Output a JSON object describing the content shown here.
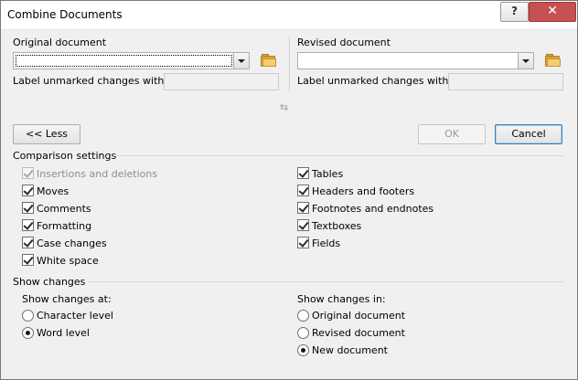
{
  "window": {
    "title": "Combine Documents",
    "help_label": "?",
    "close_label": "✕"
  },
  "original": {
    "label": "Original document",
    "value": "",
    "unmarked_label": "Label unmarked changes with:",
    "unmarked_value": ""
  },
  "revised": {
    "label": "Revised document",
    "value": "",
    "unmarked_label": "Label unmarked changes with:",
    "unmarked_value": ""
  },
  "icons": {
    "browse": "folder-icon",
    "swap": "swap-arrows-icon"
  },
  "swap_glyph": "⇆",
  "buttons": {
    "less": "<< Less",
    "ok": "OK",
    "cancel": "Cancel"
  },
  "comparison": {
    "heading": "Comparison settings",
    "left": [
      {
        "label": "Insertions and deletions",
        "checked": true,
        "disabled": true
      },
      {
        "label": "Moves",
        "checked": true,
        "disabled": false
      },
      {
        "label": "Comments",
        "checked": true,
        "disabled": false
      },
      {
        "label": "Formatting",
        "checked": true,
        "disabled": false
      },
      {
        "label": "Case changes",
        "checked": true,
        "disabled": false
      },
      {
        "label": "White space",
        "checked": true,
        "disabled": false
      }
    ],
    "right": [
      {
        "label": "Tables",
        "checked": true,
        "disabled": false
      },
      {
        "label": "Headers and footers",
        "checked": true,
        "disabled": false
      },
      {
        "label": "Footnotes and endnotes",
        "checked": true,
        "disabled": false
      },
      {
        "label": "Textboxes",
        "checked": true,
        "disabled": false
      },
      {
        "label": "Fields",
        "checked": true,
        "disabled": false
      }
    ]
  },
  "show_changes": {
    "heading": "Show changes",
    "at_label": "Show changes at:",
    "at_options": [
      {
        "label": "Character level",
        "selected": false
      },
      {
        "label": "Word level",
        "selected": true
      }
    ],
    "in_label": "Show changes in:",
    "in_options": [
      {
        "label": "Original document",
        "selected": false
      },
      {
        "label": "Revised document",
        "selected": false
      },
      {
        "label": "New document",
        "selected": true
      }
    ]
  },
  "colors": {
    "close_button": "#c75050",
    "default_border": "#3c7fb1"
  }
}
